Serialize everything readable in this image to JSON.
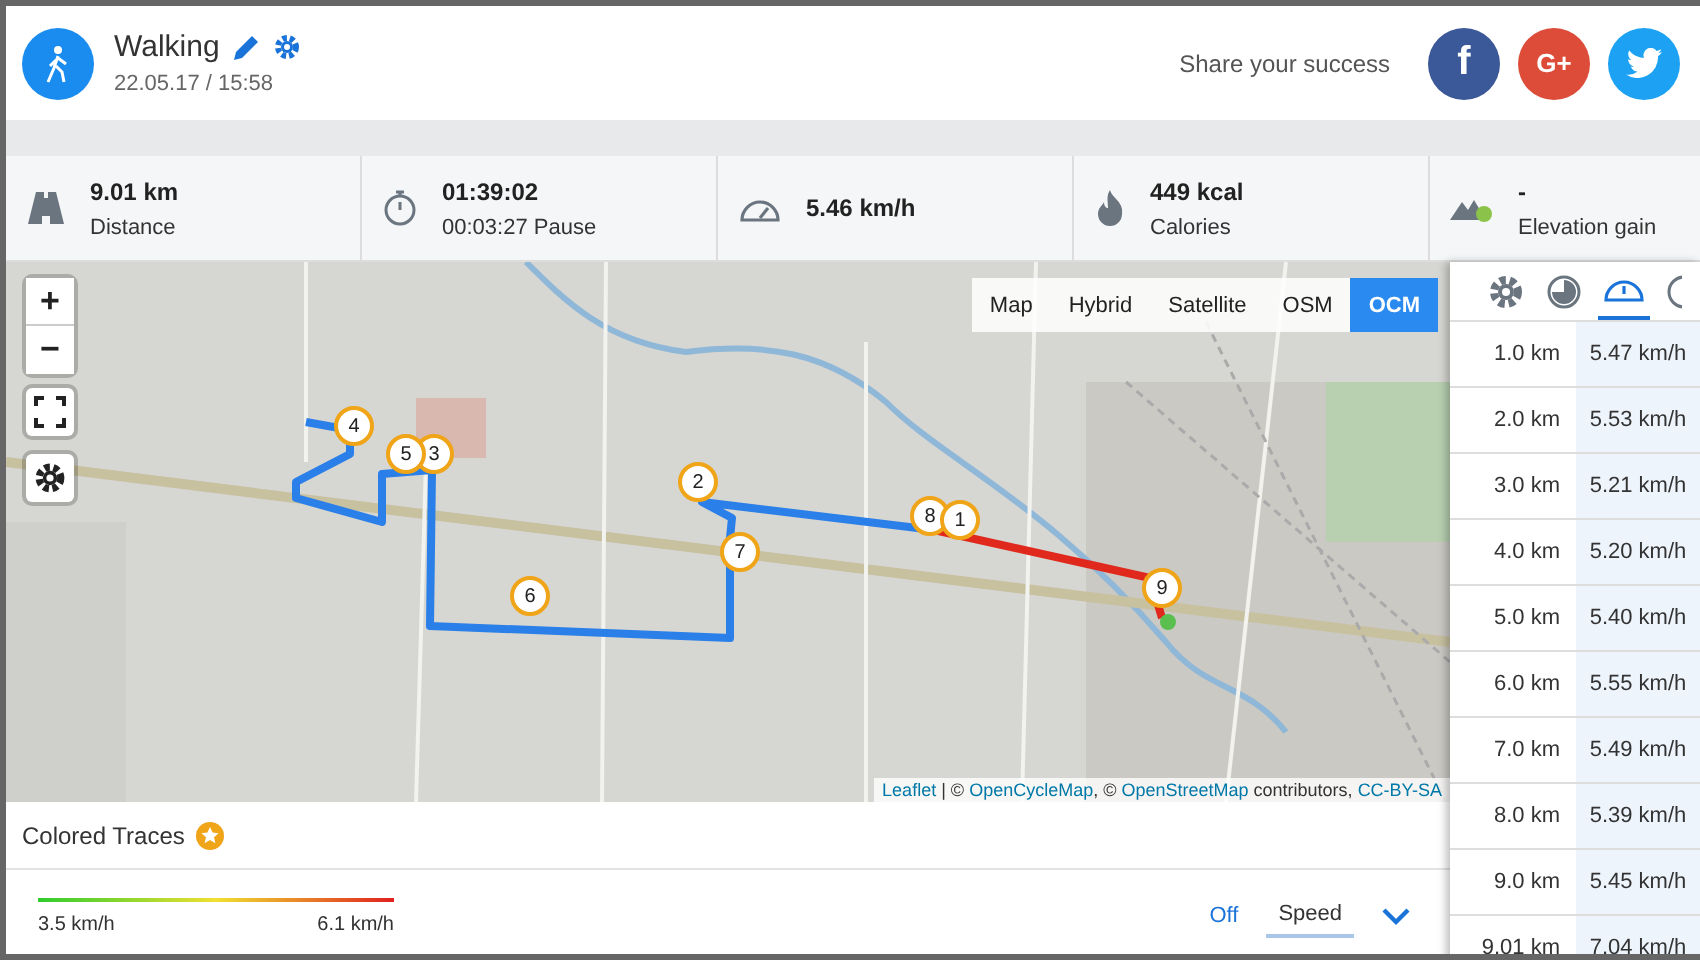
{
  "activity": {
    "title": "Walking",
    "date": "22.05.17 / 15:58"
  },
  "share": {
    "label": "Share your success",
    "buttons": [
      {
        "kind": "facebook",
        "label": "f"
      },
      {
        "kind": "google",
        "label": "G+"
      },
      {
        "kind": "twitter"
      }
    ]
  },
  "stats": [
    {
      "kind": "distance",
      "value": "9.01 km",
      "label": "Distance"
    },
    {
      "kind": "duration",
      "value": "01:39:02",
      "label": "00:03:27 Pause"
    },
    {
      "kind": "speed",
      "value": "5.46 km/h"
    },
    {
      "kind": "calories",
      "value": "449 kcal",
      "label": "Calories"
    },
    {
      "kind": "elevation",
      "value": "-",
      "label": "Elevation gain"
    }
  ],
  "map": {
    "layers": [
      {
        "label": "Map",
        "selected": false
      },
      {
        "label": "Hybrid",
        "selected": false
      },
      {
        "label": "Satellite",
        "selected": false
      },
      {
        "label": "OSM",
        "selected": false
      },
      {
        "label": "OCM",
        "selected": true
      }
    ],
    "zoom_in": "+",
    "zoom_out": "−",
    "markers": [
      "8",
      "1",
      "2",
      "3",
      "5",
      "4",
      "6",
      "7",
      "9"
    ],
    "attribution": [
      {
        "text": "Leaflet",
        "link": true
      },
      {
        "text": " | © ",
        "link": false
      },
      {
        "text": "OpenCycleMap",
        "link": true
      },
      {
        "text": ", © ",
        "link": false
      },
      {
        "text": "OpenStreetMap",
        "link": true
      },
      {
        "text": " contributors, ",
        "link": false
      },
      {
        "text": "CC-BY-SA",
        "link": true
      }
    ]
  },
  "splits": {
    "tabs": [
      {
        "kind": "settings",
        "selected": false
      },
      {
        "kind": "pace",
        "selected": false
      },
      {
        "kind": "speed",
        "selected": true
      },
      {
        "kind": "clock",
        "selected": false
      }
    ],
    "rows": [
      {
        "distance": "1.0 km",
        "speed": "5.47 km/h"
      },
      {
        "distance": "2.0 km",
        "speed": "5.53 km/h"
      },
      {
        "distance": "3.0 km",
        "speed": "5.21 km/h"
      },
      {
        "distance": "4.0 km",
        "speed": "5.20 km/h"
      },
      {
        "distance": "5.0 km",
        "speed": "5.40 km/h"
      },
      {
        "distance": "6.0 km",
        "speed": "5.55 km/h"
      },
      {
        "distance": "7.0 km",
        "speed": "5.49 km/h"
      },
      {
        "distance": "8.0 km",
        "speed": "5.39 km/h"
      },
      {
        "distance": "9.0 km",
        "speed": "5.45 km/h"
      },
      {
        "distance": "9.01 km",
        "speed": "7.04 km/h"
      }
    ]
  },
  "colored_traces": {
    "title": "Colored Traces",
    "min": "3.5 km/h",
    "max": "6.1 km/h",
    "options": [
      {
        "label": "Off",
        "selected": false
      },
      {
        "label": "Speed",
        "selected": true
      }
    ]
  }
}
